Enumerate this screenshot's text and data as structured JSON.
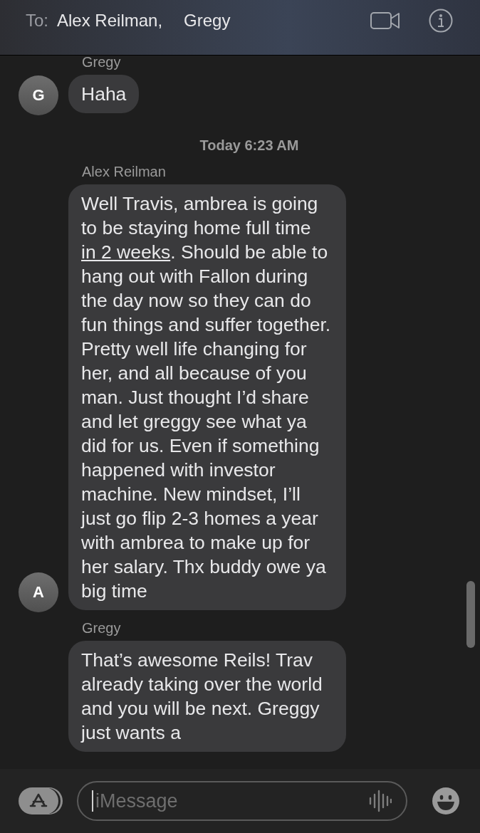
{
  "header": {
    "to_label": "To:",
    "recipients": [
      "Alex Reilman,",
      "Gregy"
    ]
  },
  "messages": [
    {
      "kind": "name",
      "text": "Gregy"
    },
    {
      "kind": "bubble",
      "avatar": "G",
      "segments": [
        {
          "kind": "plain",
          "text": "Haha"
        }
      ]
    },
    {
      "kind": "time",
      "text": "Today 6:23 AM"
    },
    {
      "kind": "name",
      "text": "Alex Reilman"
    },
    {
      "kind": "bubble",
      "avatar": "A",
      "segments": [
        {
          "kind": "plain",
          "text": "Well Travis, ambrea is going to be staying home full time "
        },
        {
          "kind": "link",
          "text": "in 2 weeks"
        },
        {
          "kind": "plain",
          "text": ". Should be able to hang out with Fallon during the day now so they can do fun things and suffer together. Pretty well life changing for her, and all because of you man. Just thought I’d share and let greggy see what ya did for us. Even if something happened with investor machine. New mindset, I’ll just go flip 2-3 homes a year with ambrea to make up for her salary. Thx buddy owe ya big time"
        }
      ]
    },
    {
      "kind": "name",
      "text": "Gregy"
    },
    {
      "kind": "bubble",
      "segments": [
        {
          "kind": "plain",
          "text": "That’s awesome Reils! Trav already taking over the world and you will be next.  Greggy just wants a"
        }
      ]
    }
  ],
  "composer": {
    "placeholder": "iMessage"
  }
}
